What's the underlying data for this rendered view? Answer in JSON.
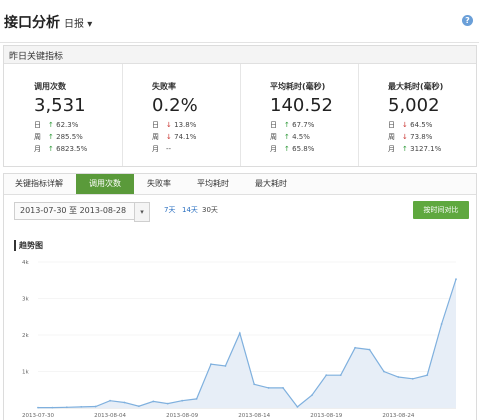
{
  "header": {
    "title": "接口分析",
    "range_label": "日报",
    "range_caret": "▾",
    "help_icon": "?"
  },
  "summary": {
    "title": "昨日关键指标",
    "cards": [
      {
        "title": "调用次数",
        "value": "3,531",
        "rows": [
          {
            "label": "日",
            "dir": "up",
            "arrow": "↑",
            "pct": "62.3%"
          },
          {
            "label": "周",
            "dir": "up",
            "arrow": "↑",
            "pct": "285.5%"
          },
          {
            "label": "月",
            "dir": "up",
            "arrow": "↑",
            "pct": "6823.5%"
          }
        ]
      },
      {
        "title": "失败率",
        "value": "0.2%",
        "rows": [
          {
            "label": "日",
            "dir": "down",
            "arrow": "↓",
            "pct": "13.8%"
          },
          {
            "label": "周",
            "dir": "down",
            "arrow": "↓",
            "pct": "74.1%"
          },
          {
            "label": "月",
            "dir": "none",
            "arrow": "",
            "pct": "--"
          }
        ]
      },
      {
        "title": "平均耗时(毫秒)",
        "value": "140.52",
        "rows": [
          {
            "label": "日",
            "dir": "up",
            "arrow": "↑",
            "pct": "67.7%"
          },
          {
            "label": "周",
            "dir": "up",
            "arrow": "↑",
            "pct": "4.5%"
          },
          {
            "label": "月",
            "dir": "up",
            "arrow": "↑",
            "pct": "65.8%"
          }
        ]
      },
      {
        "title": "最大耗时(毫秒)",
        "value": "5,002",
        "rows": [
          {
            "label": "日",
            "dir": "down",
            "arrow": "↓",
            "pct": "64.5%"
          },
          {
            "label": "周",
            "dir": "down",
            "arrow": "↓",
            "pct": "73.8%"
          },
          {
            "label": "月",
            "dir": "up",
            "arrow": "↑",
            "pct": "3127.1%"
          }
        ]
      }
    ]
  },
  "detail": {
    "section_label": "关键指标详解",
    "tabs": [
      "调用次数",
      "失败率",
      "平均耗时",
      "最大耗时"
    ],
    "active_tab": 0,
    "date_from": "2013-07-30",
    "date_sep": "至",
    "date_to": "2013-08-28",
    "dropdown_caret": "▾",
    "quick_ranges": [
      "7天",
      "14天",
      "30天"
    ],
    "compare_button": "按时间对比",
    "chart_title": "趋势图"
  },
  "colors": {
    "accent_green": "#5a9a3a",
    "button_green": "#5fa83f",
    "up_green": "#2f9a3a",
    "down_red": "#c9302c",
    "line_blue": "#7fb0de",
    "area_fill": "#e7eef7"
  },
  "chart_data": {
    "type": "area",
    "title": "趋势图",
    "xlabel": "",
    "ylabel": "",
    "ylim": [
      0,
      4000
    ],
    "yticks": [
      "1k",
      "2k",
      "3k",
      "4k"
    ],
    "grid": true,
    "x_tick_labels": [
      "2013-07-30",
      "2013-08-04",
      "2013-08-09",
      "2013-08-14",
      "2013-08-19",
      "2013-08-24"
    ],
    "x": [
      "2013-07-30",
      "2013-07-31",
      "2013-08-01",
      "2013-08-02",
      "2013-08-03",
      "2013-08-04",
      "2013-08-05",
      "2013-08-06",
      "2013-08-07",
      "2013-08-08",
      "2013-08-09",
      "2013-08-10",
      "2013-08-11",
      "2013-08-12",
      "2013-08-13",
      "2013-08-14",
      "2013-08-15",
      "2013-08-16",
      "2013-08-17",
      "2013-08-18",
      "2013-08-19",
      "2013-08-20",
      "2013-08-21",
      "2013-08-22",
      "2013-08-23",
      "2013-08-24",
      "2013-08-25",
      "2013-08-26",
      "2013-08-27",
      "2013-08-28"
    ],
    "series": [
      {
        "name": "",
        "values": [
          10,
          10,
          20,
          30,
          40,
          200,
          150,
          50,
          180,
          120,
          200,
          250,
          1200,
          1150,
          2050,
          650,
          550,
          550,
          30,
          350,
          900,
          900,
          1650,
          1600,
          1000,
          850,
          800,
          900,
          2300,
          3530
        ]
      }
    ]
  }
}
